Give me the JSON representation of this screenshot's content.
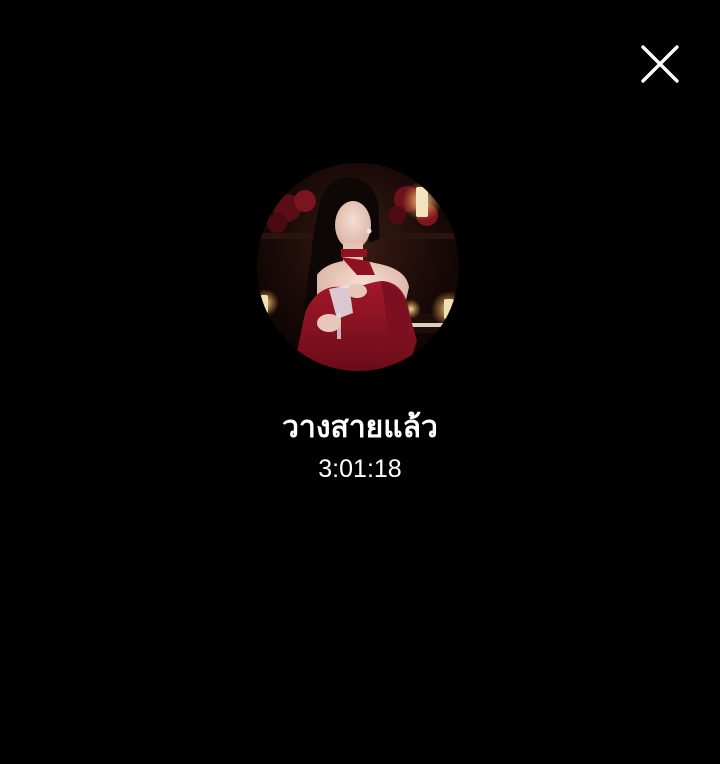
{
  "call": {
    "status_text": "วางสายแล้ว",
    "duration": "3:01:18"
  },
  "controls": {
    "close_icon": "close-icon"
  },
  "colors": {
    "background": "#000000",
    "text": "#ffffff",
    "avatar_dress": "#8e1220"
  }
}
